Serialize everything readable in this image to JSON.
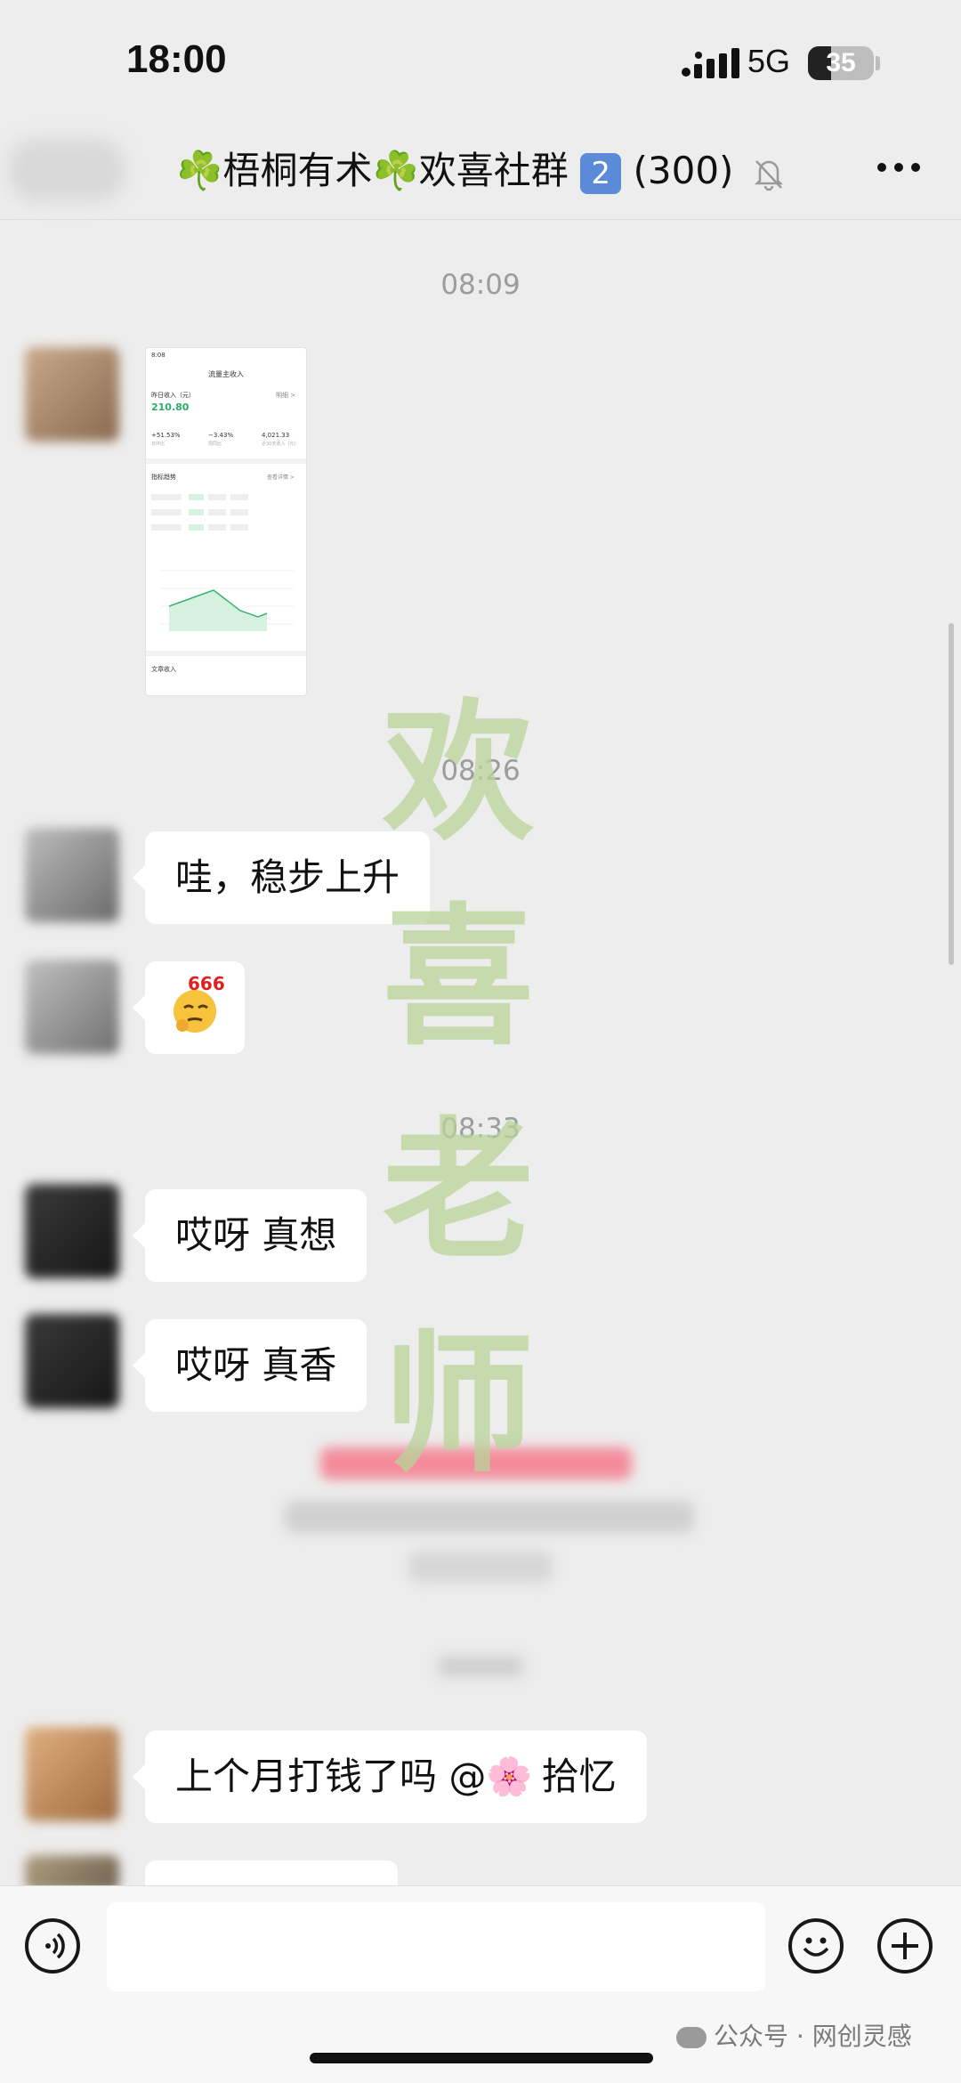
{
  "status_bar": {
    "time": "18:00",
    "network": "5G",
    "battery": "35",
    "battery_level": 0.35
  },
  "header": {
    "title": "☘️梧桐有术☘️欢喜社群",
    "group_index": "2",
    "member_count": "(300)"
  },
  "messages": {
    "ts1": "08:09",
    "ts2": "08:26",
    "msg1": "哇，稳步上升",
    "emoji_tag": "666",
    "ts3": "08:33",
    "msg2": "哎呀 真想",
    "msg3": "哎呀 真香",
    "msg4_prefix": "上个月打钱了吗 @",
    "msg4_emoji": "🌸",
    "msg4_name": "拾忆"
  },
  "screenshot": {
    "status_time": "8:08",
    "title": "流量主收入",
    "yesterday_label": "昨日收入（元）",
    "detail_link": "明细 >",
    "yesterday_value": "210.80",
    "stats": [
      "+51.53%",
      "−3.43%",
      "4,021.33"
    ],
    "stat_labels": [
      "日环比",
      "周同比",
      "近30天收入（元）"
    ],
    "trend_label": "指标趋势",
    "trend_link": "查看详情 >",
    "section_footer": "文章收入"
  },
  "watermark": [
    "欢",
    "喜",
    "老",
    "师"
  ],
  "footer": {
    "source": "公众号 · 网创灵感"
  },
  "icons": [
    "voice-icon",
    "emoji-icon",
    "plus-icon",
    "mute-icon",
    "more-icon"
  ]
}
